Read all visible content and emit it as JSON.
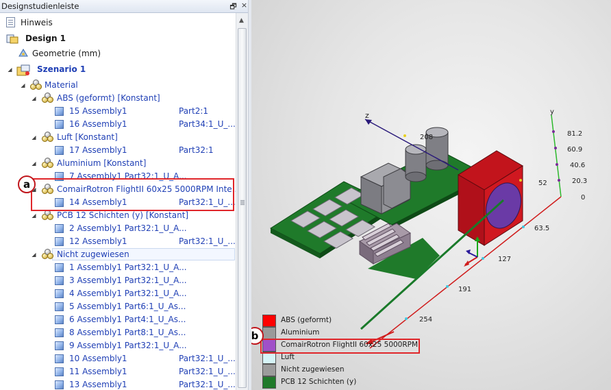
{
  "panel": {
    "title": "Designstudienleiste",
    "pin_glyph": "🗗",
    "close_glyph": "×"
  },
  "tree": {
    "hinweis": "Hinweis",
    "design": "Design 1",
    "geometrie": "Geometrie (mm)",
    "szenario": "Szenario 1",
    "material": "Material",
    "groups": [
      {
        "name": "ABS (geformt) [Konstant]",
        "items": [
          {
            "label": "15 Assembly1",
            "part": "Part2:1"
          },
          {
            "label": "16 Assembly1",
            "part": "Part34:1_U_..."
          }
        ]
      },
      {
        "name": "Luft [Konstant]",
        "items": [
          {
            "label": "17 Assembly1",
            "part": "Part32:1"
          }
        ]
      },
      {
        "name": "Aluminium [Konstant]",
        "items": [
          {
            "label": "7 Assembly1  Part32:1_U_A..."
          }
        ]
      },
      {
        "name": "ComairRotron FlightII 60x25 5000RPM Inte...",
        "items": [
          {
            "label": "14 Assembly1",
            "part": "Part32:1_U_..."
          }
        ]
      },
      {
        "name": "PCB 12 Schichten (y) [Konstant]",
        "items": [
          {
            "label": "2 Assembly1  Part32:1_U_A..."
          },
          {
            "label": "12 Assembly1",
            "part": "Part32:1_U_..."
          }
        ]
      },
      {
        "name": "Nicht zugewiesen",
        "items": [
          {
            "label": "1 Assembly1  Part32:1_U_A..."
          },
          {
            "label": "3 Assembly1  Part32:1_U_A..."
          },
          {
            "label": "4 Assembly1  Part32:1_U_A..."
          },
          {
            "label": "5 Assembly1  Part6:1_U_As..."
          },
          {
            "label": "6 Assembly1  Part4:1_U_As..."
          },
          {
            "label": "8 Assembly1  Part8:1_U_As..."
          },
          {
            "label": "9 Assembly1  Part32:1_U_A..."
          },
          {
            "label": "10 Assembly1",
            "part": "Part32:1_U_..."
          },
          {
            "label": "11 Assembly1",
            "part": "Part32:1_U_..."
          },
          {
            "label": "13 Assembly1",
            "part": "Part32:1_U_..."
          }
        ]
      }
    ]
  },
  "callouts": {
    "a": "a",
    "b": "b"
  },
  "axes": {
    "z_label": "z",
    "y_label": "y",
    "y_ticks": [
      "81.2",
      "60.9",
      "40.6",
      "20.3",
      "0"
    ],
    "x_ticks": [
      "63.5",
      "127",
      "191",
      "254"
    ],
    "z_ticks": [
      "52",
      "208"
    ]
  },
  "legend": [
    {
      "label": "ABS (geformt)",
      "color": "#ff0000"
    },
    {
      "label": "Aluminium",
      "color": "#9a9a9a"
    },
    {
      "label": "ComairRotron FlightII 60x25 5000RPM",
      "color": "#a050c8"
    },
    {
      "label": "Luft",
      "color": "#d6f4f7"
    },
    {
      "label": "Nicht zugewiesen",
      "color": "#9c9c9c"
    },
    {
      "label": "PCB 12 Schichten (y)",
      "color": "#1f7a2a"
    }
  ]
}
